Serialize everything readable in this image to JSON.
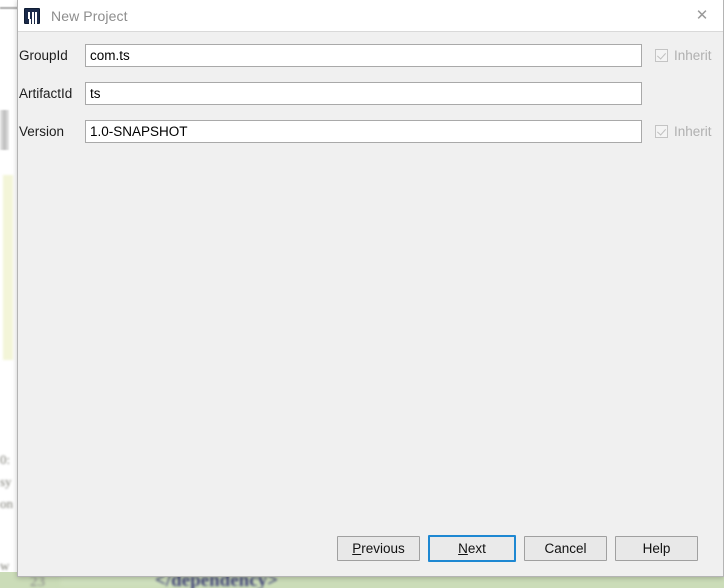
{
  "window": {
    "title": "New Project",
    "app_icon": "intellij-idea-icon",
    "close_icon": "close-icon"
  },
  "form": {
    "rows": [
      {
        "label": "GroupId",
        "value": "com.ts",
        "placeholder": "",
        "inherit_label": "Inherit",
        "has_inherit": true
      },
      {
        "label": "ArtifactId",
        "value": "ts",
        "placeholder": "",
        "inherit_label": "",
        "has_inherit": false
      },
      {
        "label": "Version",
        "value": "1.0-SNAPSHOT",
        "placeholder": "",
        "inherit_label": "Inherit",
        "has_inherit": true
      }
    ]
  },
  "buttons": {
    "previous": {
      "label": "Previous",
      "mnemonic": "P",
      "rest": "revious"
    },
    "next": {
      "label": "Next",
      "mnemonic": "N",
      "rest": "ext"
    },
    "cancel": {
      "label": "Cancel"
    },
    "help": {
      "label": "Help"
    }
  },
  "background": {
    "code_fragment": "</dependency>",
    "line_number": "23",
    "left_fragments": [
      "0:",
      "sy",
      "on",
      "w"
    ]
  },
  "colors": {
    "dialog_bg": "#f0f0f0",
    "titlebar_bg": "#ffffff",
    "accent_focus": "#1e88d2",
    "field_bg": "#ffffff",
    "disabled_text": "#b0b0b0"
  }
}
